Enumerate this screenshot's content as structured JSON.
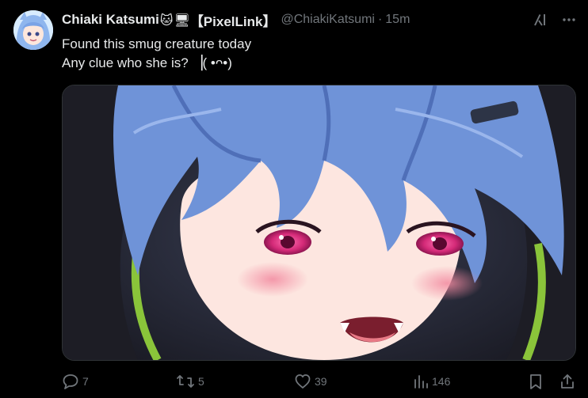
{
  "author": {
    "display_name": "Chiaki Katsumi",
    "emoji_cat": "🐱",
    "emoji_monitor": "🖥",
    "tag": "【PixelLink】",
    "handle": "@ChiakiKatsumi",
    "separator": "·",
    "time": "15m"
  },
  "tweet": {
    "line1": "Found this smug creature today",
    "line2": "Any clue who she is? ▕( •ᴖ•)"
  },
  "actions": {
    "replies": "7",
    "reposts": "5",
    "likes": "39",
    "views": "146"
  },
  "icons": {
    "reply": "reply-icon",
    "repost": "repost-icon",
    "like": "heart-icon",
    "views": "views-chart-icon",
    "bookmark": "bookmark-icon",
    "share": "share-icon",
    "grok": "grok-icon",
    "more": "more-icon"
  },
  "colors": {
    "background": "#000000",
    "text": "#e7e9ea",
    "muted": "#71767b",
    "hair": "#6f93d8",
    "eyes": "#e0307c"
  }
}
